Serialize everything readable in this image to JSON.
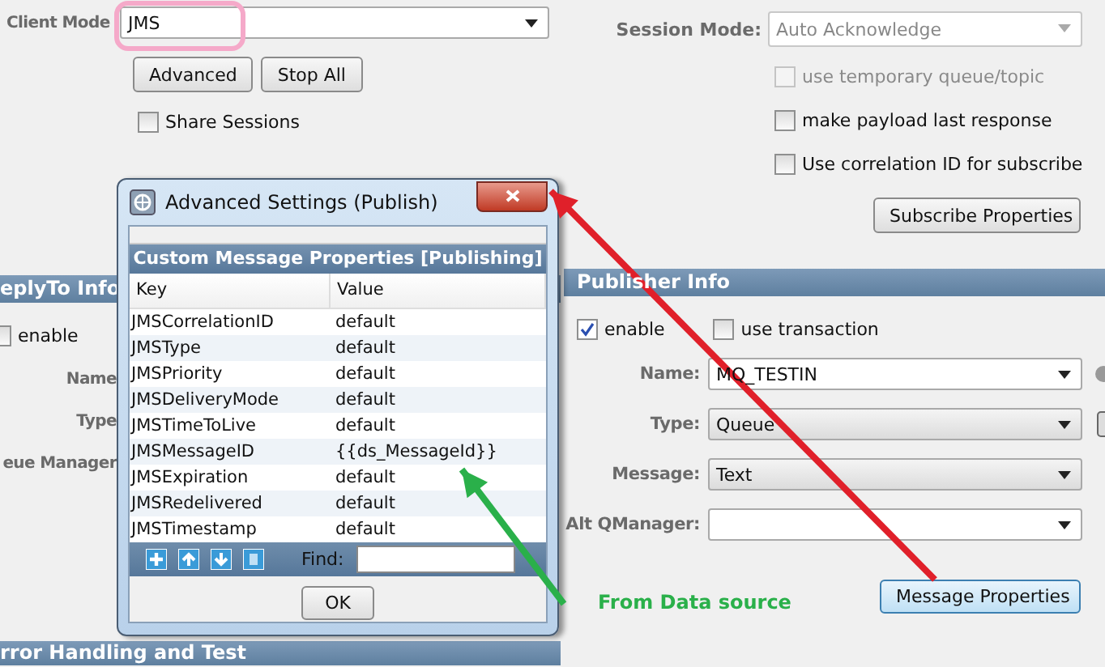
{
  "client_mode": {
    "label": "Client Mode",
    "value": "JMS"
  },
  "buttons": [
    "Advanced",
    "Stop All"
  ],
  "share_sessions": {
    "label": "Share Sessions",
    "checked": false
  },
  "session_mode": {
    "label": "Session Mode:",
    "value": "Auto Acknowledge",
    "disabled": true
  },
  "right_options": [
    {
      "label": "use temporary queue/topic",
      "checked": false,
      "disabled": true
    },
    {
      "label": "make payload last response",
      "checked": false,
      "disabled": false
    },
    {
      "label": "Use correlation ID for subscribe",
      "checked": false,
      "disabled": false
    }
  ],
  "subscribe_button": "Subscribe Properties",
  "reply_to": {
    "title": "eplyTo Info",
    "enable": {
      "label": "enable",
      "checked": false
    },
    "fields": [
      "Name",
      "Type",
      "eue Manager"
    ]
  },
  "publisher": {
    "title": "Publisher Info",
    "enable": {
      "label": "enable",
      "checked": true
    },
    "transaction": {
      "label": "use transaction",
      "checked": false
    },
    "fields": [
      {
        "label": "Name:",
        "value": "MQ_TESTIN",
        "editable": true
      },
      {
        "label": "Type:",
        "value": "Queue",
        "editable": false
      },
      {
        "label": "Message:",
        "value": "Text",
        "editable": false
      },
      {
        "label": "Alt QManager:",
        "editable": true
      }
    ],
    "button": "Message Properties"
  },
  "bottom_section": {
    "title": "rror Handling and Test"
  },
  "dialog": {
    "title": "Advanced Settings (Publish)",
    "heading": "Custom Message Properties [Publishing]",
    "columns": [
      "Key",
      "Value"
    ],
    "rows": [
      [
        "JMSCorrelationID",
        "default"
      ],
      [
        "JMSType",
        "default"
      ],
      [
        "JMSPriority",
        "default"
      ],
      [
        "JMSDeliveryMode",
        "default"
      ],
      [
        "JMSTimeToLive",
        "default"
      ],
      [
        "JMSMessageID",
        "{{ds_MessageId}}"
      ],
      [
        "JMSExpiration",
        "default"
      ],
      [
        "JMSRedelivered",
        "default"
      ],
      [
        "JMSTimestamp",
        "default"
      ]
    ],
    "find_label": "Find:",
    "ok": "OK"
  },
  "annotations": [
    {
      "kind": "highlight",
      "color": "#f5a9c9"
    },
    {
      "kind": "arrow",
      "color": "#e0202a"
    },
    {
      "kind": "arrow",
      "color": "#2ab04a",
      "label": "From Data source"
    }
  ]
}
